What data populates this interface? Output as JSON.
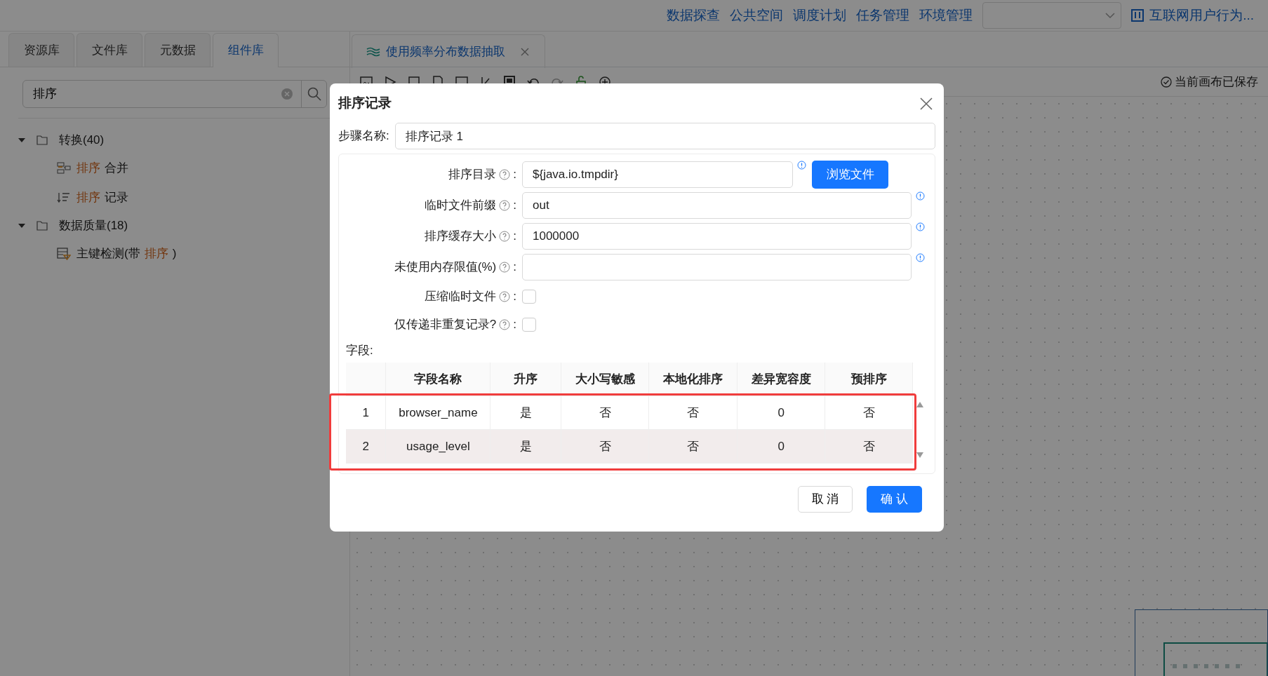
{
  "top_nav": {
    "links": [
      "数据探查",
      "公共空间",
      "调度计划",
      "任务管理",
      "环境管理"
    ],
    "project": "互联网用户行为..."
  },
  "left_tabs": [
    {
      "label": "资源库",
      "selected": false
    },
    {
      "label": "文件库",
      "selected": false
    },
    {
      "label": "元数据",
      "selected": false
    },
    {
      "label": "组件库",
      "selected": true
    }
  ],
  "search": {
    "value": "排序"
  },
  "tree": [
    {
      "label": "转换(40)",
      "expanded": true,
      "children": [
        {
          "kind": "merge",
          "segments": [
            {
              "text": "排序",
              "highlight": true
            },
            {
              "text": "合并",
              "highlight": false
            }
          ]
        },
        {
          "kind": "sort",
          "segments": [
            {
              "text": "排序",
              "highlight": true
            },
            {
              "text": "记录",
              "highlight": false
            }
          ]
        }
      ]
    },
    {
      "label": "数据质量(18)",
      "expanded": true,
      "children": [
        {
          "kind": "check",
          "segments": [
            {
              "text": "主键检测(带",
              "highlight": false
            },
            {
              "text": "排序",
              "highlight": true
            },
            {
              "text": ")",
              "highlight": false
            }
          ]
        }
      ]
    }
  ],
  "editor_tab": {
    "title": "使用频率分布数据抽取"
  },
  "save_status": "当前画布已保存",
  "dialog": {
    "title": "排序记录",
    "step_name_label": "步骤名称:",
    "step_name": "排序记录 1",
    "fields": [
      {
        "kind": "text",
        "label": "排序目录",
        "separator": ":",
        "value": "${java.io.tmpdir}",
        "button": "浏览文件"
      },
      {
        "kind": "text",
        "label": "临时文件前缀",
        "separator": ":",
        "value": "out"
      },
      {
        "kind": "text",
        "label": "排序缓存大小",
        "separator": ":",
        "value": "1000000"
      },
      {
        "kind": "text",
        "label": "未使用内存限值(%)",
        "separator": ":"
      },
      {
        "kind": "checkbox",
        "label": "压缩临时文件",
        "separator": ":",
        "checked": false
      },
      {
        "kind": "checkbox",
        "label": "仅传递非重复记录?",
        "separator": ":",
        "checked": false
      }
    ],
    "fields_label": "字段:",
    "table": {
      "highlighted": true,
      "columns": [
        "字段名称",
        "升序",
        "大小写敏感",
        "本地化排序",
        "差异宽容度",
        "预排序"
      ],
      "rows": [
        {
          "index": "1",
          "cells": [
            "browser_name",
            "是",
            "否",
            "否",
            "0",
            "否"
          ],
          "selected": false
        },
        {
          "index": "2",
          "cells": [
            "usage_level",
            "是",
            "否",
            "否",
            "0",
            "否"
          ],
          "selected": true
        }
      ]
    },
    "cancel": "取 消",
    "confirm": "确 认"
  }
}
